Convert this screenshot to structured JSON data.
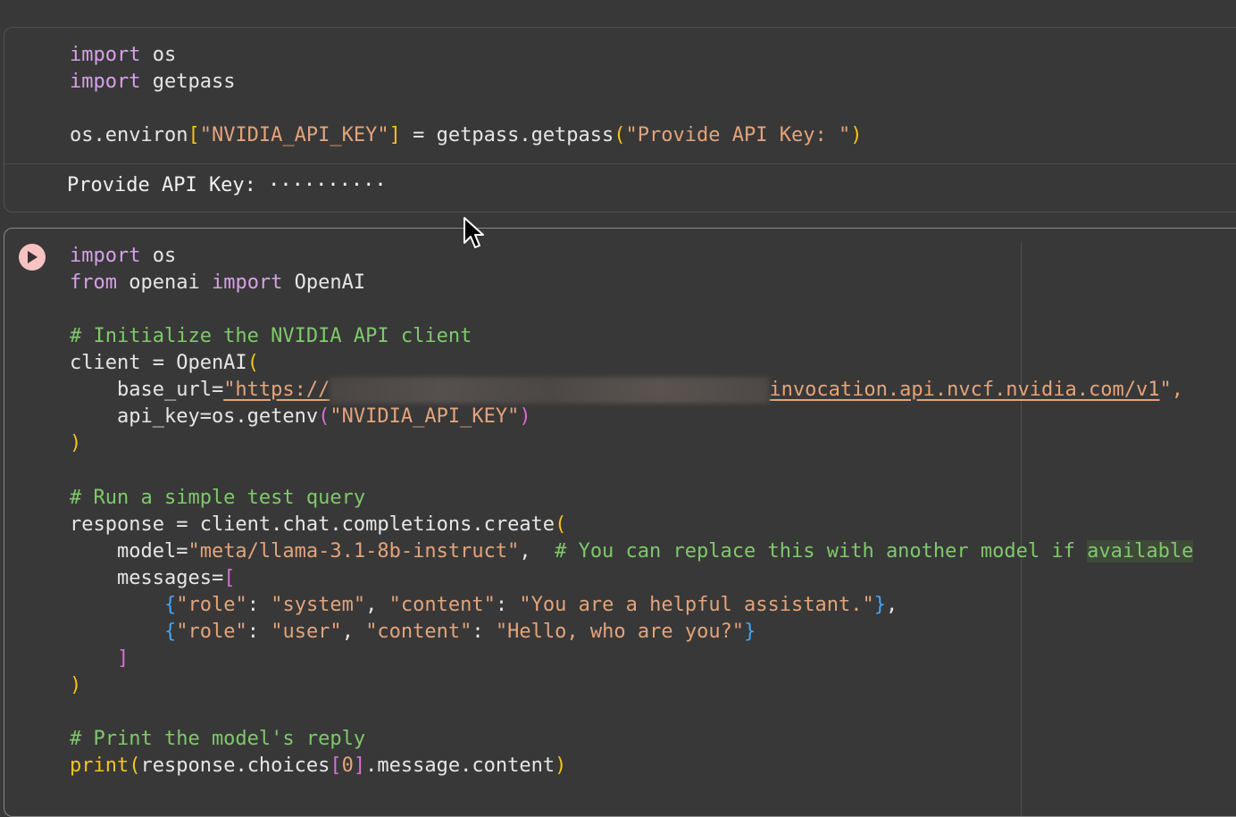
{
  "cells": [
    {
      "lines": [
        {
          "t1": "import",
          "t2": " os"
        },
        {
          "t1": "import",
          "t2": " getpass"
        },
        {
          "a": "os.environ",
          "b": "[",
          "c": "\"NVIDIA_API_KEY\"",
          "d": "]",
          "e": " = getpass.getpass",
          "f": "(",
          "g": "\"Provide API Key: \"",
          "h": ")"
        }
      ],
      "output": "Provide API Key: ··········"
    },
    {
      "run_icon": "play-icon",
      "lines": {
        "l1": {
          "kw": "import",
          "rest": " os"
        },
        "l2": {
          "kw1": "from",
          "mid": " openai ",
          "kw2": "import",
          "rest": " OpenAI"
        },
        "c1": "# Initialize the NVIDIA API client",
        "l4": {
          "pre": "client = OpenAI",
          "br": "("
        },
        "l5": {
          "pre": "    base_url=",
          "str1": "\"https://",
          "url_rest": "invocation.api.nvcf.nvidia.com/v1",
          "end": "\","
        },
        "l6": {
          "pre": "    api_key=os.getenv",
          "br": "(",
          "str": "\"NVIDIA_API_KEY\"",
          "br_close": ")"
        },
        "l7": ")",
        "c2": "# Run a simple test query",
        "l9": {
          "pre": "response = client.chat.completions.create",
          "br": "("
        },
        "l10": {
          "pre": "    model=",
          "str": "\"meta/llama-3.1-8b-instruct\"",
          "comma": ",  ",
          "cm": "# You can replace this with another model if ",
          "cm_hl": "available"
        },
        "l11": {
          "pre": "    messages=",
          "br": "["
        },
        "l12": {
          "ob": "{",
          "k1": "\"role\"",
          "p1": ": ",
          "v1": "\"system\"",
          "p2": ", ",
          "k2": "\"content\"",
          "p3": ": ",
          "v2": "\"You are a helpful assistant.\"",
          "cb": "}",
          "end": ","
        },
        "l13": {
          "ob": "{",
          "k1": "\"role\"",
          "p1": ": ",
          "v1": "\"user\"",
          "p2": ", ",
          "k2": "\"content\"",
          "p3": ": ",
          "v2": "\"Hello, who are you?\"",
          "cb": "}"
        },
        "l14": "]",
        "l15": ")",
        "c3": "# Print the model's reply",
        "l17": {
          "fn": "print",
          "ob": "(",
          "mid": "response.choices",
          "bo": "[",
          "idx": "0",
          "bc": "]",
          "rest": ".message.content",
          "cb": ")"
        }
      }
    }
  ],
  "colors": {
    "background": "#383838",
    "keyword": "#d7a0e8",
    "string": "#e3a47b",
    "comment": "#7fc96b",
    "bracket_level1": "#f5c518",
    "bracket_level2": "#d66fd4",
    "bracket_level3": "#42a5f5"
  }
}
